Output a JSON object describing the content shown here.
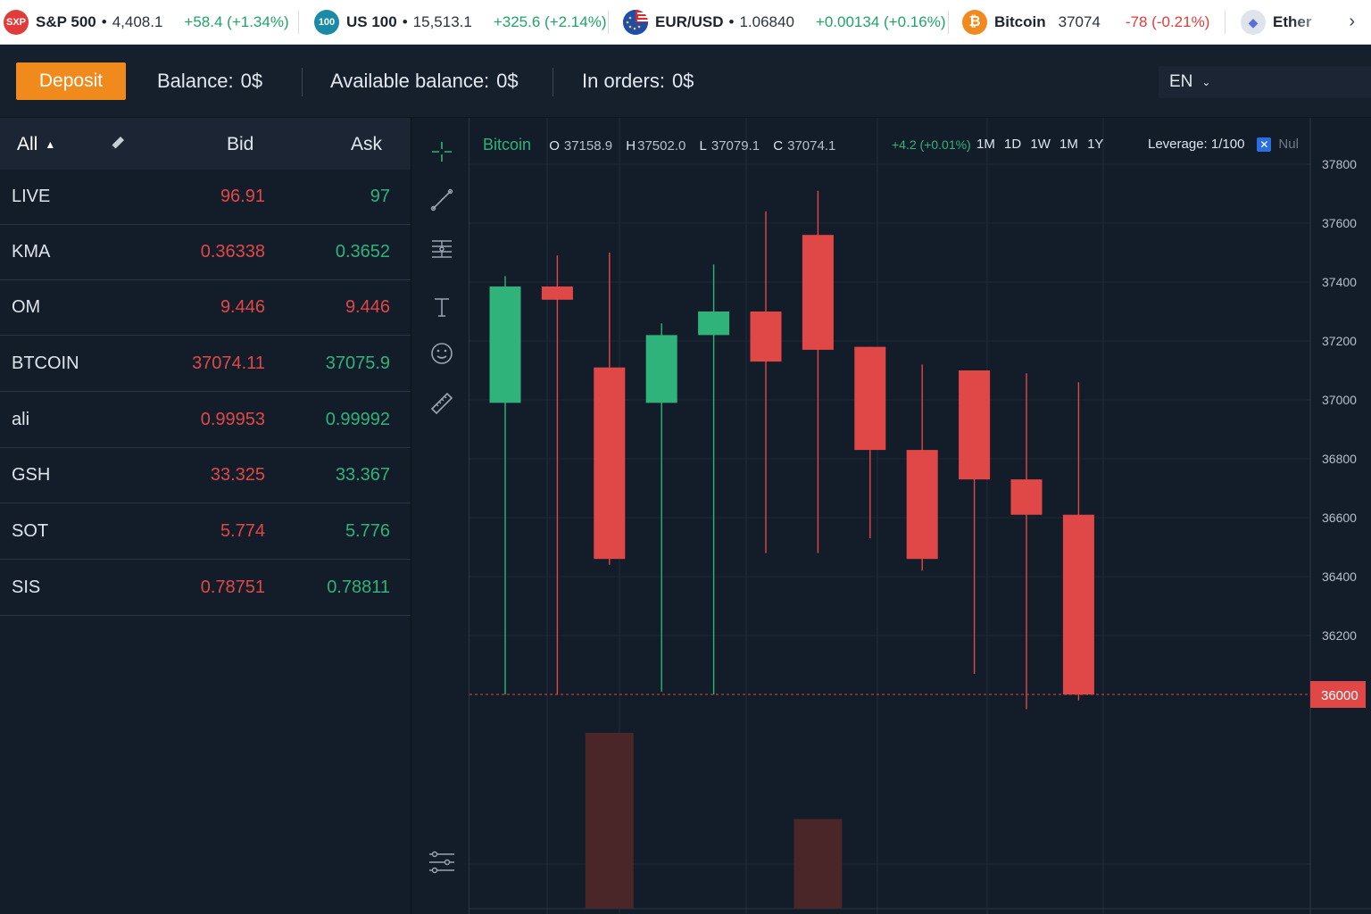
{
  "ticker": {
    "items": [
      {
        "logo": "SXP",
        "logo_color": "#e23b3b",
        "name": "S&P 500",
        "price": "4,408.1",
        "change": "+58.4 (+1.34%)",
        "dir": "up"
      },
      {
        "logo": "100",
        "logo_color": "#1a8aa6",
        "name": "US 100",
        "price": "15,513.1",
        "change": "+325.6 (+2.14%)",
        "dir": "up"
      },
      {
        "logo": "",
        "logo_color": "#1f4ea8",
        "name": "EUR/USD",
        "price": "1.06840",
        "change": "+0.00134 (+0.16%)",
        "dir": "up"
      },
      {
        "logo": "₿",
        "logo_color": "#f08a1c",
        "name": "Bitcoin",
        "price": "37074",
        "change": "-78 (-0.21%)",
        "dir": "down"
      },
      {
        "logo": "◆",
        "logo_color": "#dfe3ea",
        "name": "Ether",
        "price": "",
        "change": "",
        "dir": "up"
      }
    ]
  },
  "account": {
    "deposit_label": "Deposit",
    "balance_label": "Balance:",
    "balance_value": "0$",
    "available_label": "Available balance:",
    "available_value": "0$",
    "orders_label": "In orders:",
    "orders_value": "0$",
    "language": "EN"
  },
  "watchlist": {
    "filter_label": "All",
    "bid_header": "Bid",
    "ask_header": "Ask",
    "rows": [
      {
        "symbol": "LIVE",
        "bid": "96.91",
        "ask": "97",
        "ask_dir": "up"
      },
      {
        "symbol": "KMA",
        "bid": "0.36338",
        "ask": "0.3652",
        "ask_dir": "up"
      },
      {
        "symbol": "OM",
        "bid": "9.446",
        "ask": "9.446",
        "ask_dir": "down"
      },
      {
        "symbol": "BTCOIN",
        "bid": "37074.11",
        "ask": "37075.9",
        "ask_dir": "up"
      },
      {
        "symbol": "ali",
        "bid": "0.99953",
        "ask": "0.99992",
        "ask_dir": "up"
      },
      {
        "symbol": "GSH",
        "bid": "33.325",
        "ask": "33.367",
        "ask_dir": "up"
      },
      {
        "symbol": "SOT",
        "bid": "5.774",
        "ask": "5.776",
        "ask_dir": "up"
      },
      {
        "symbol": "SIS",
        "bid": "0.78751",
        "ask": "0.78811",
        "ask_dir": "up"
      }
    ]
  },
  "toolbar": {
    "tools": [
      "crosshair-icon",
      "trend-line-icon",
      "fib-levels-icon",
      "text-icon",
      "emoji-icon",
      "ruler-icon"
    ],
    "settings_icon": "sliders-icon"
  },
  "chart": {
    "symbol": "Bitcoin",
    "o_label": "O",
    "o_value": "37158.9",
    "h_label": "H",
    "h_value": "37502.0",
    "l_label": "L",
    "l_value": "37079.1",
    "c_label": "C",
    "c_value": "37074.1",
    "change": "+4.2 (+0.01%)",
    "timeframes": [
      "1M",
      "1D",
      "1W",
      "1M",
      "1Y"
    ],
    "leverage_label": "Leverage: 1/100",
    "leverage_extra": "Nul",
    "last_price_label": "36000"
  },
  "colors": {
    "up": "#2fb37a",
    "down": "#e04848",
    "volume": "#4a2629",
    "accent": "#f08a1c"
  },
  "chart_data": {
    "type": "candlestick",
    "y_ticks": [
      37800,
      37600,
      37400,
      37200,
      37000,
      36800,
      36600,
      36400,
      36200
    ],
    "ylim": [
      35275,
      37983
    ],
    "last_price": 36000,
    "candles": [
      {
        "o": 36990,
        "h": 37420,
        "l": 36000,
        "c": 37385
      },
      {
        "o": 37385,
        "h": 37490,
        "l": 36000,
        "c": 37340
      },
      {
        "o": 37110,
        "h": 37500,
        "l": 36440,
        "c": 36460
      },
      {
        "o": 36990,
        "h": 37260,
        "l": 36010,
        "c": 37220
      },
      {
        "o": 37220,
        "h": 37460,
        "l": 36000,
        "c": 37300
      },
      {
        "o": 37300,
        "h": 37640,
        "l": 36480,
        "c": 37130
      },
      {
        "o": 37560,
        "h": 37710,
        "l": 36480,
        "c": 37170
      },
      {
        "o": 37180,
        "h": 37180,
        "l": 36530,
        "c": 36830
      },
      {
        "o": 36830,
        "h": 37120,
        "l": 36420,
        "c": 36460
      },
      {
        "o": 37100,
        "h": 37100,
        "l": 36070,
        "c": 36730
      },
      {
        "o": 36730,
        "h": 37090,
        "l": 35950,
        "c": 36610
      },
      {
        "o": 36610,
        "h": 37060,
        "l": 35980,
        "c": 36000
      }
    ],
    "volume": [
      0,
      0,
      1.0,
      0,
      0,
      0,
      0.51,
      0,
      0,
      0,
      0,
      0
    ]
  }
}
